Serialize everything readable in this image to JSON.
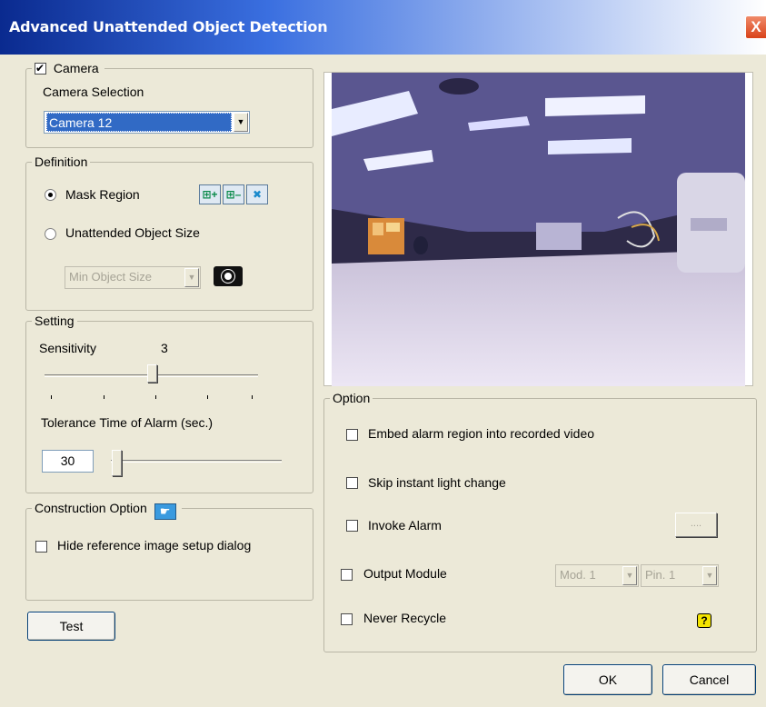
{
  "window": {
    "title": "Advanced Unattended Object Detection",
    "close_glyph": "X"
  },
  "camera": {
    "legend": "Camera",
    "checked": true,
    "selection_label": "Camera Selection",
    "selected": "Camera 12"
  },
  "definition": {
    "legend": "Definition",
    "mask_region": "Mask Region",
    "unattended_object_size": "Unattended Object Size",
    "object_size_placeholder": "Min Object Size",
    "add_icon": "⊞+",
    "remove_icon": "⊞–",
    "clear_icon": "✖"
  },
  "setting": {
    "legend": "Setting",
    "sensitivity_label": "Sensitivity",
    "sensitivity_value": "3",
    "tolerance_label": "Tolerance Time of Alarm (sec.)",
    "tolerance_value": "30"
  },
  "construction": {
    "legend": "Construction Option",
    "hide_reference": "Hide reference image setup dialog"
  },
  "buttons": {
    "test": "Test",
    "ok": "OK",
    "cancel": "Cancel",
    "browse": "...."
  },
  "option": {
    "legend": "Option",
    "embed_alarm": "Embed alarm region into recorded video",
    "skip_light": "Skip instant light change",
    "invoke_alarm": "Invoke Alarm",
    "output_module": "Output Module",
    "module_select": "Mod. 1",
    "pin_select": "Pin. 1",
    "never_recycle": "Never Recycle",
    "help_icon": "?"
  },
  "colors": {
    "title_bar": "#0a2a8f",
    "select_highlight": "#316ac5",
    "dialog_bg": "#ece9d8"
  }
}
